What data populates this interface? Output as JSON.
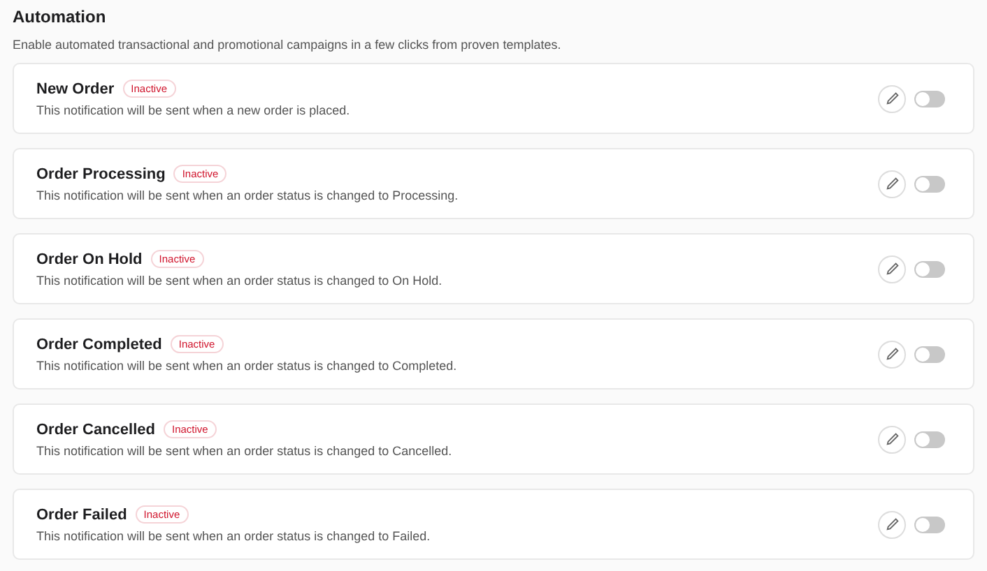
{
  "header": {
    "title": "Automation",
    "description": "Enable automated transactional and promotional campaigns in a few clicks from proven templates."
  },
  "automations": [
    {
      "title": "New Order",
      "status": "Inactive",
      "active": false,
      "description": "This notification will be sent when a new order is placed.",
      "on": false
    },
    {
      "title": "Order Processing",
      "status": "Inactive",
      "active": false,
      "description": "This notification will be sent when an order status is changed to Processing.",
      "on": false
    },
    {
      "title": "Order On Hold",
      "status": "Inactive",
      "active": false,
      "description": "This notification will be sent when an order status is changed to On Hold.",
      "on": false
    },
    {
      "title": "Order Completed",
      "status": "Inactive",
      "active": false,
      "description": "This notification will be sent when an order status is changed to Completed.",
      "on": false
    },
    {
      "title": "Order Cancelled",
      "status": "Inactive",
      "active": false,
      "description": "This notification will be sent when an order status is changed to Cancelled.",
      "on": false
    },
    {
      "title": "Order Failed",
      "status": "Inactive",
      "active": false,
      "description": "This notification will be sent when an order status is changed to Failed.",
      "on": false
    }
  ]
}
